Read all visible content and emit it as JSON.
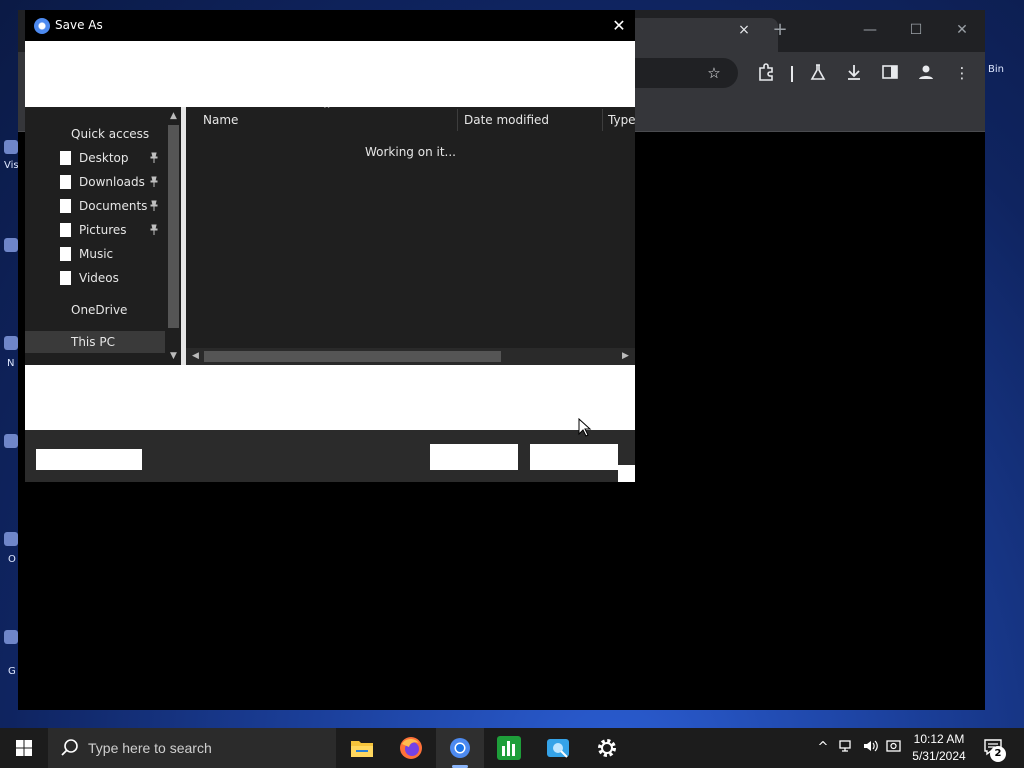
{
  "desktop": {
    "labels": [
      "Vis",
      "N",
      "O",
      "G",
      "Bin"
    ]
  },
  "browser": {
    "tab_close": "×",
    "new_tab": "+",
    "window_controls": {
      "minimize": "—",
      "maximize": "☐",
      "close": "✕"
    },
    "toolbar_icons": [
      "star-icon",
      "extensions-icon",
      "labs-icon",
      "download-icon",
      "side-panel-icon",
      "profile-icon",
      "menu-icon"
    ]
  },
  "dialog": {
    "title": "Save As",
    "close": "✕",
    "nav": {
      "items": [
        {
          "label": "Quick access",
          "icon": false,
          "pinned": false
        },
        {
          "label": "Desktop",
          "icon": true,
          "pinned": true
        },
        {
          "label": "Downloads",
          "icon": true,
          "pinned": true
        },
        {
          "label": "Documents",
          "icon": true,
          "pinned": true
        },
        {
          "label": "Pictures",
          "icon": true,
          "pinned": true
        },
        {
          "label": "Music",
          "icon": true,
          "pinned": false
        },
        {
          "label": "Videos",
          "icon": true,
          "pinned": false
        },
        {
          "label": "OneDrive",
          "icon": false,
          "pinned": false
        },
        {
          "label": "This PC",
          "icon": false,
          "pinned": false,
          "selected": true
        }
      ],
      "pin_glyph": "📌"
    },
    "file_list": {
      "columns": [
        "Name",
        "Date modified",
        "Type"
      ],
      "status": "Working on it..."
    }
  },
  "taskbar": {
    "search_placeholder": "Type here to search",
    "apps": [
      "file-explorer",
      "firefox",
      "chrome",
      "task-manager",
      "photos",
      "settings"
    ],
    "active_app": "chrome",
    "clock": {
      "time": "10:12 AM",
      "date": "5/31/2024"
    },
    "notifications_count": "2"
  },
  "colors": {
    "dialog_dark": "#2b2b2b",
    "pane_dark": "#1f1f1f",
    "accent_blue": "#4d8af0"
  }
}
